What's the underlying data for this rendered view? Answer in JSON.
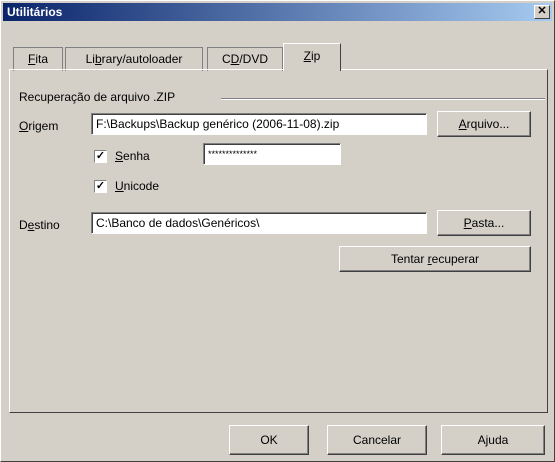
{
  "window": {
    "title": "Utilitários",
    "close_glyph": "✕"
  },
  "tabs": [
    {
      "label": "Fita",
      "accel": "F"
    },
    {
      "label": "Library/autoloader",
      "accel": "b"
    },
    {
      "label": "CD/DVD",
      "accel": "D"
    },
    {
      "label": "Zip",
      "accel": "Z"
    }
  ],
  "active_tab": "Zip",
  "group": {
    "label": "Recuperação de arquivo .ZIP"
  },
  "origem": {
    "label": "Origem",
    "value": "F:\\Backups\\Backup genérico (2006-11-08).zip"
  },
  "arquivo_button": "Arquivo...",
  "senha": {
    "label": "Senha",
    "checked": true,
    "value": "**************"
  },
  "unicode": {
    "label": "Unicode",
    "checked": true
  },
  "destino": {
    "label": "Destino",
    "value": "C:\\Banco de dados\\Genéricos\\"
  },
  "pasta_button": "Pasta...",
  "tentar_button": "Tentar recuperar",
  "footer": {
    "ok": "OK",
    "cancel": "Cancelar",
    "help": "Ajuda"
  }
}
